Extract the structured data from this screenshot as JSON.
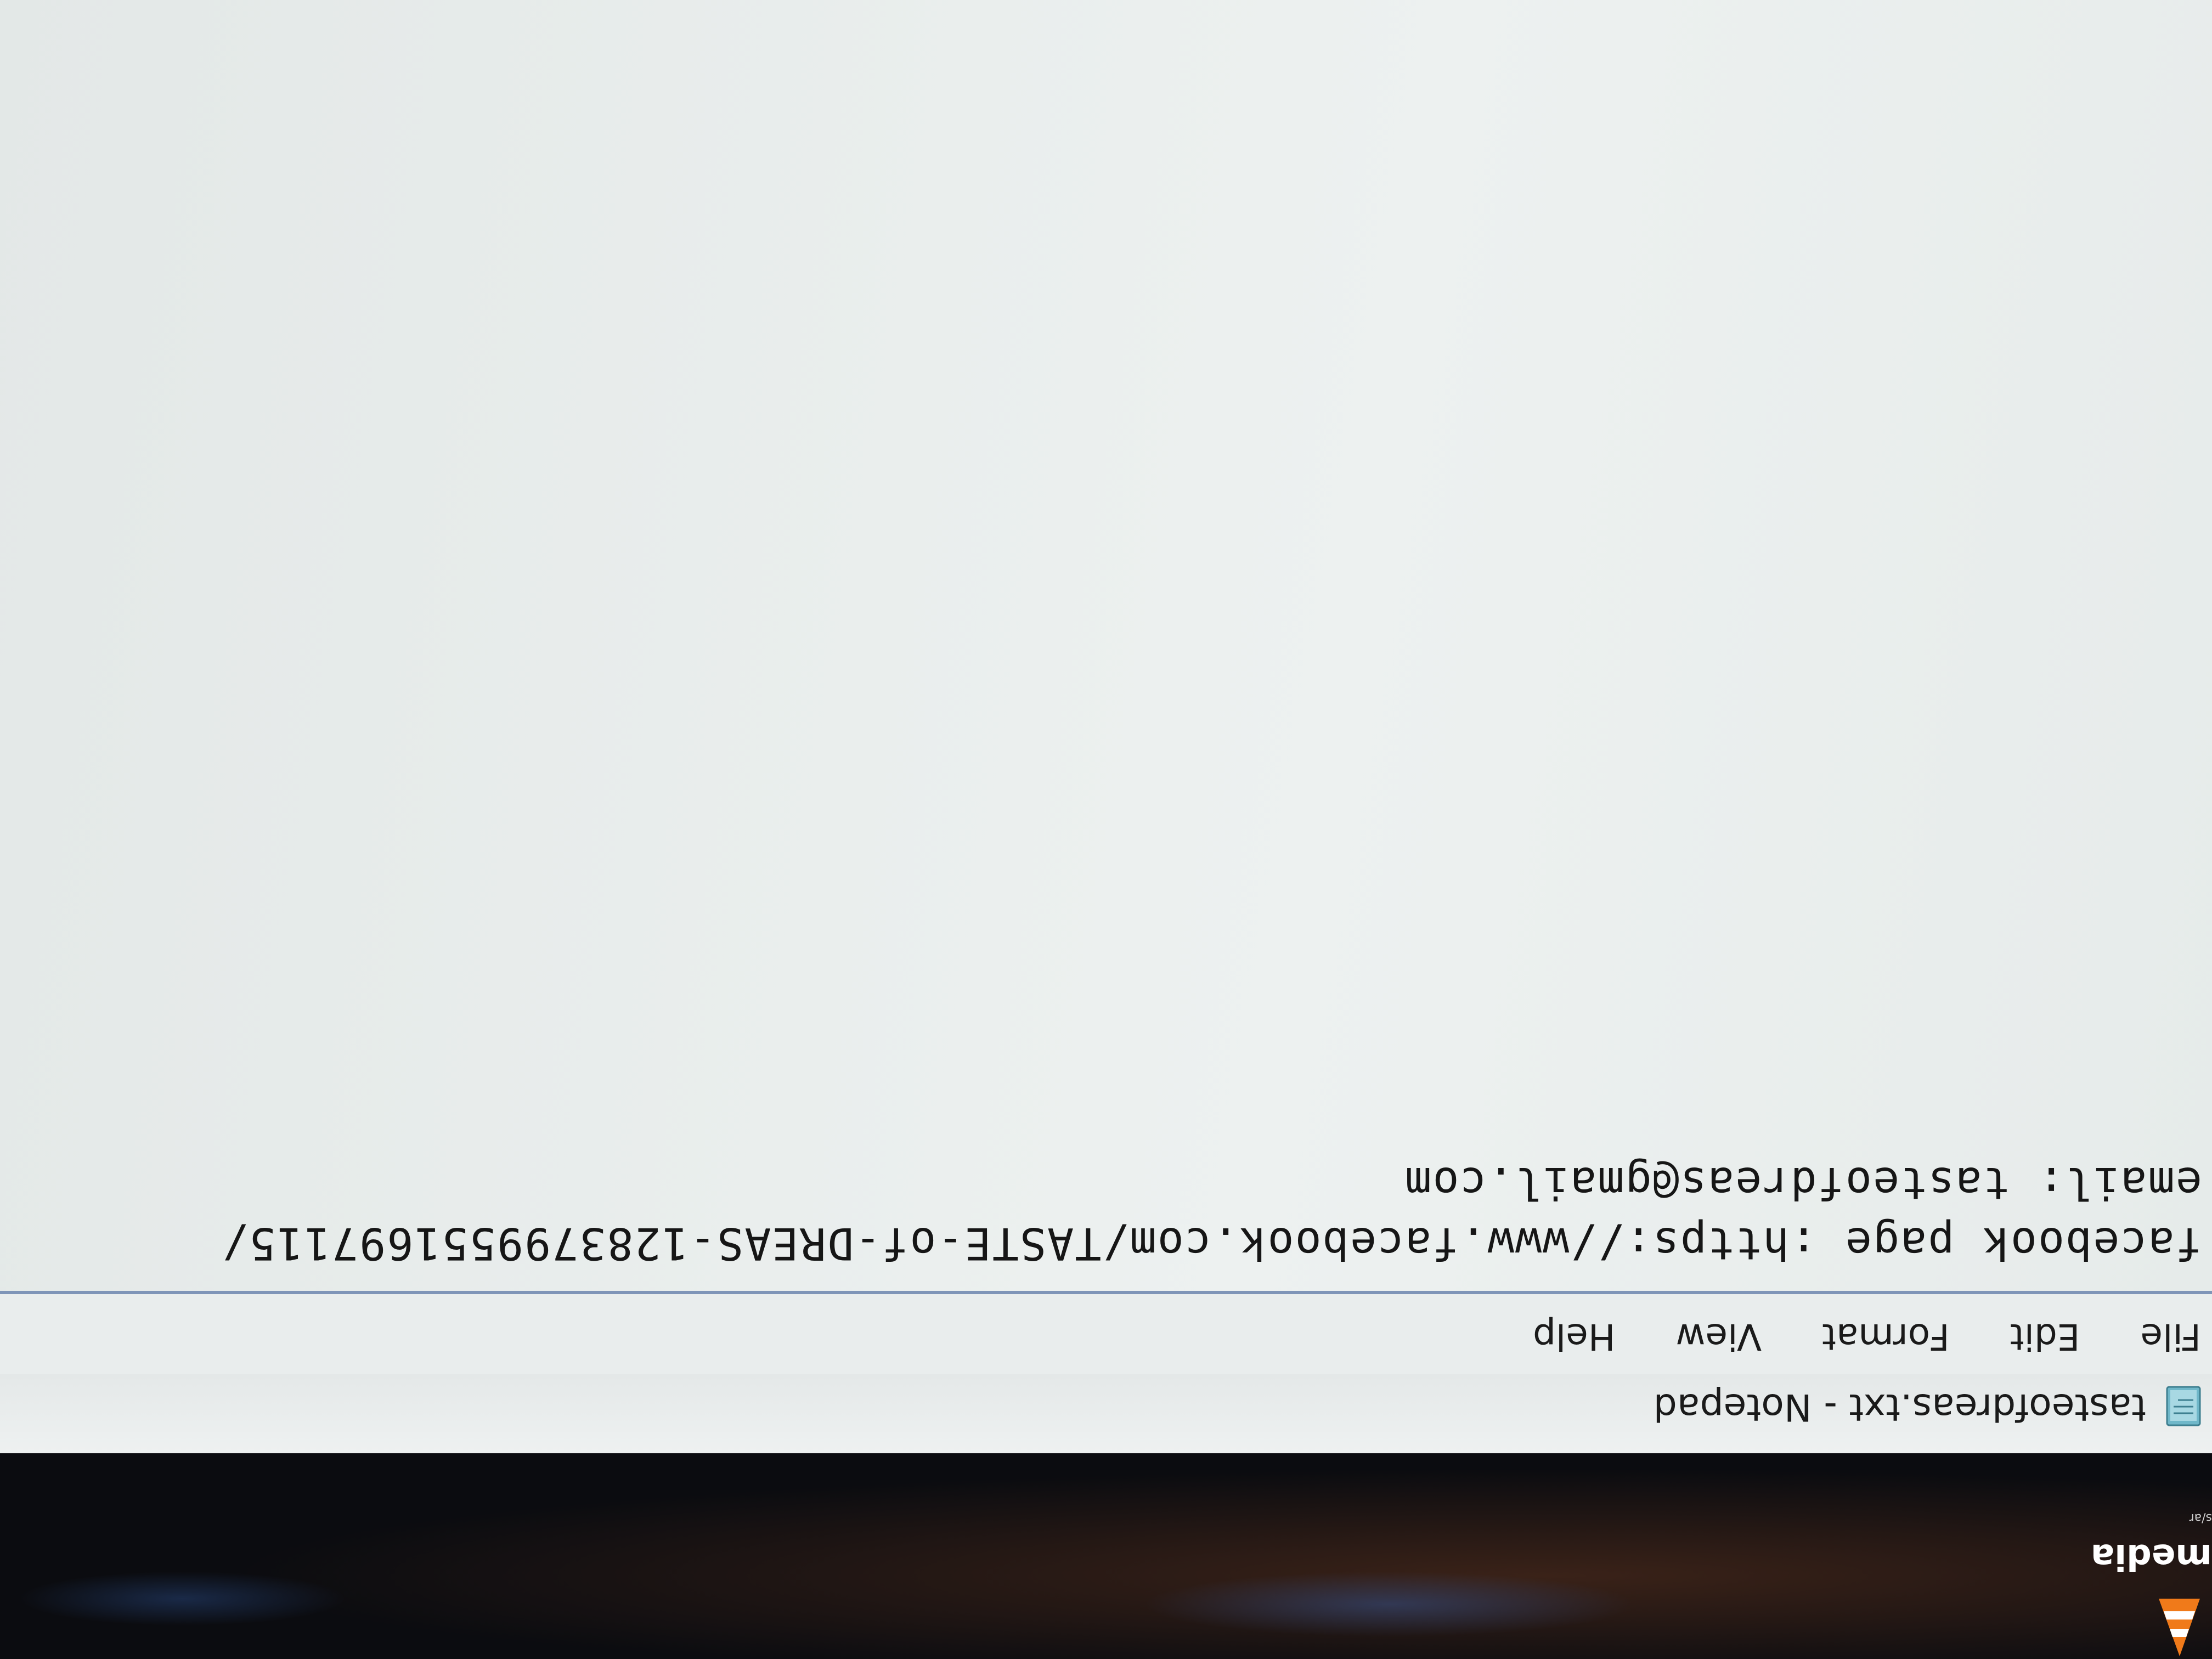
{
  "desktop": {
    "icon_label": "media",
    "icon_sublabel": "s/ar"
  },
  "window": {
    "title": "tasteofdreas.txt - Notepad",
    "menu": [
      {
        "label": "File"
      },
      {
        "label": "Edit"
      },
      {
        "label": "Format"
      },
      {
        "label": "View"
      },
      {
        "label": "Help"
      }
    ]
  },
  "editor": {
    "lines": [
      "facebook page :https://www.facebook.com/TASTE-of-DREAS-1283799551697115/",
      "email: tasteofdreas@gmail.com"
    ]
  },
  "icons": {
    "app_icon": "notepad-icon",
    "desktop_icon": "vlc-cone-icon"
  }
}
